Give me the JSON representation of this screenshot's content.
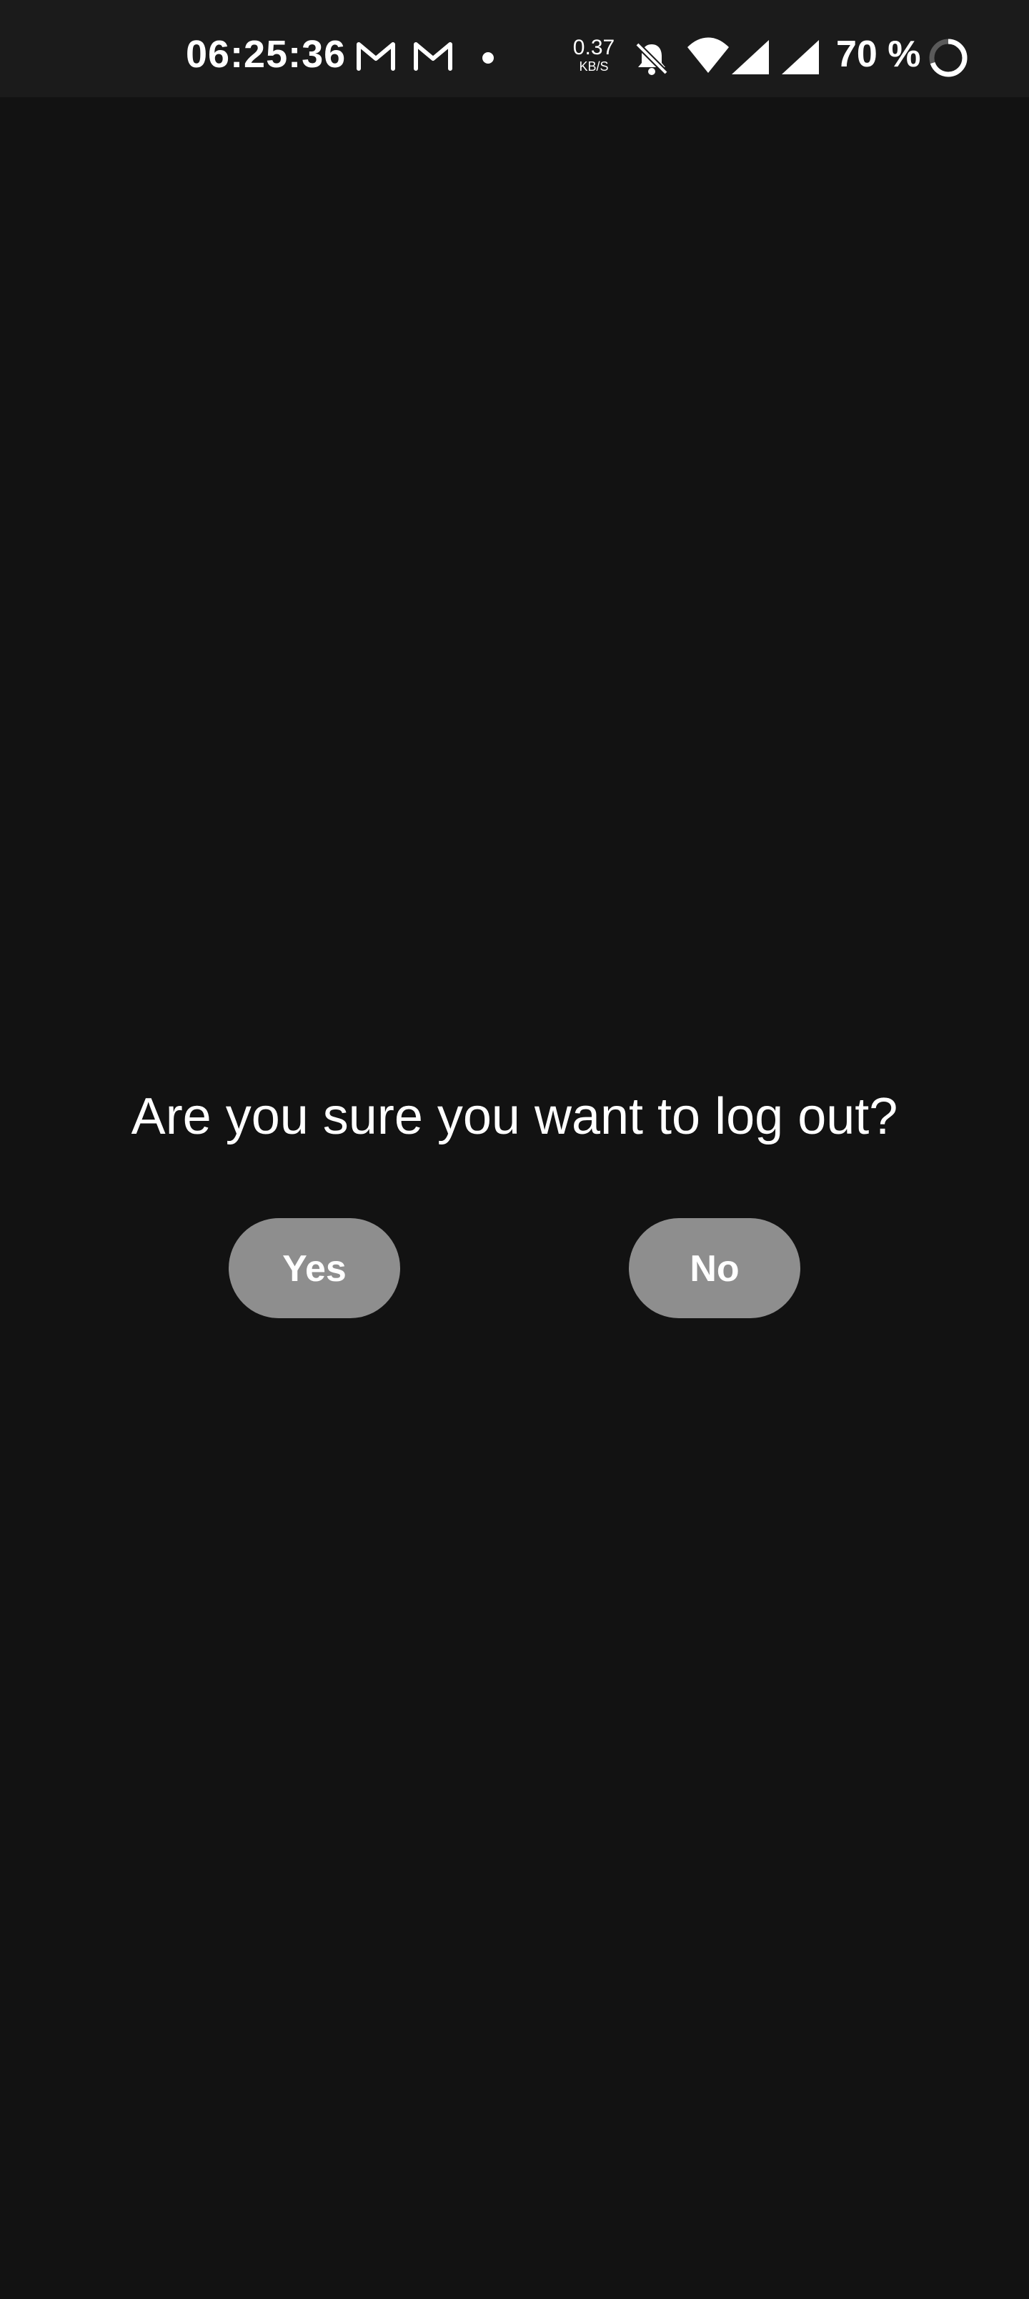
{
  "status_bar": {
    "time": "06:25:36",
    "notification_icons": [
      "gmail-icon",
      "gmail-icon",
      "dot-icon"
    ],
    "net_speed_value": "0.37",
    "net_speed_unit": "KB/S",
    "system_icons": [
      "bell-muted-icon",
      "wifi-icon",
      "cell-signal-icon",
      "cell-signal-icon"
    ],
    "battery_text": "70 %"
  },
  "dialog": {
    "prompt": "Are you sure you want to log out?",
    "yes_label": "Yes",
    "no_label": "No"
  },
  "colors": {
    "background": "#121212",
    "status_bar": "#1b1b1b",
    "button": "#8e8e8e",
    "text": "#ffffff"
  }
}
